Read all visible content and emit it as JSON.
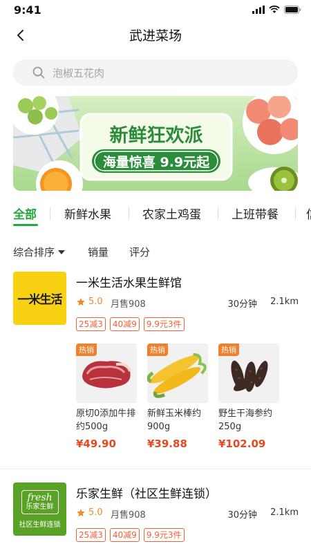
{
  "status_bar": {
    "time": "9:41"
  },
  "nav": {
    "title": "武进菜场"
  },
  "search": {
    "placeholder": "泡椒五花肉"
  },
  "banner": {
    "headline": "新鲜狂欢派",
    "subline": "海量惊喜 9.9元起"
  },
  "tabs": [
    {
      "label": "全部",
      "active": true
    },
    {
      "label": "新鲜水果"
    },
    {
      "label": "农家土鸡蛋"
    },
    {
      "label": "上班带餐"
    },
    {
      "label": "信"
    }
  ],
  "sort": [
    {
      "label": "综合排序"
    },
    {
      "label": "销量"
    },
    {
      "label": "评分"
    }
  ],
  "stores": [
    {
      "logo_text": "一米生活",
      "name": "一米生活水果生鲜馆",
      "rating": "5.0",
      "monthly_sales": "月售908",
      "delivery_time": "30分钟",
      "distance": "2.1km",
      "promos": [
        "25减3",
        "40减9",
        "9.9元3件"
      ],
      "products": [
        {
          "badge": "热销",
          "name": "原切0添加牛排约500g",
          "price": "¥49.90",
          "image": "beef"
        },
        {
          "badge": "热销",
          "name": "新鲜玉米棒约900g",
          "price": "¥39.88",
          "image": "corn"
        },
        {
          "badge": "热销",
          "name": "野生干海参约250g",
          "price": "¥102.09",
          "image": "sea-cucumber"
        }
      ]
    },
    {
      "logo_text": "fresh",
      "logo_sub": "乐家生鲜",
      "logo_caption": "社区生鲜连锁",
      "name": "乐家生鲜（社区生鲜连锁）",
      "rating": "5.0",
      "monthly_sales": "月售908",
      "delivery_time": "30分钟",
      "distance": "2.1km",
      "promos": [
        "25减3",
        "40减9",
        "9.9元3件"
      ]
    }
  ],
  "colors": {
    "accent": "#21a93a",
    "promo": "#f0613a",
    "price": "#e8481c",
    "hot_badge": "#f27f2a",
    "rating": "#f08a24"
  }
}
